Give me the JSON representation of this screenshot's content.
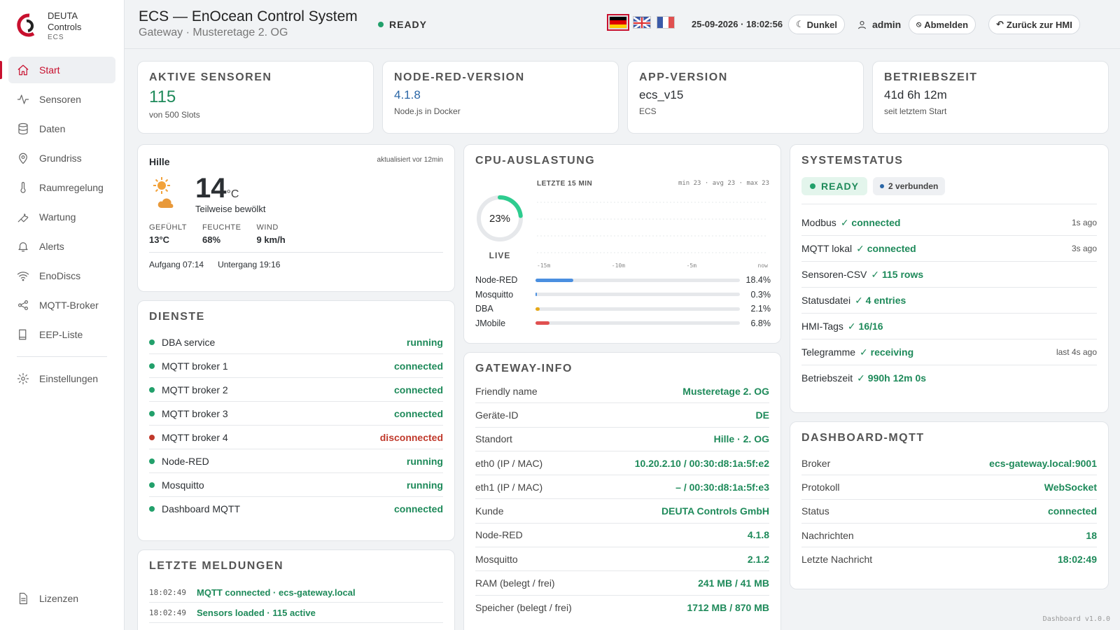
{
  "brand": {
    "line1": "DEUTA",
    "line2": "Controls",
    "line3": "ECS"
  },
  "nav": [
    {
      "label": "Start",
      "icon": "home-icon"
    },
    {
      "label": "Sensoren",
      "icon": "activity-icon"
    },
    {
      "label": "Daten",
      "icon": "database-icon"
    },
    {
      "label": "Grundriss",
      "icon": "map-pin-icon"
    },
    {
      "label": "Raumregelung",
      "icon": "thermometer-icon"
    },
    {
      "label": "Wartung",
      "icon": "wrench-icon"
    },
    {
      "label": "Alerts",
      "icon": "bell-icon"
    },
    {
      "label": "EnoDiscs",
      "icon": "wifi-icon"
    },
    {
      "label": "MQTT-Broker",
      "icon": "share-icon"
    },
    {
      "label": "EEP-Liste",
      "icon": "book-icon"
    }
  ],
  "nav_settings": "Einstellungen",
  "nav_licenses": "Lizenzen",
  "header": {
    "title": "ECS — EnOcean Control System",
    "subtitle": "Gateway · Musteretage 2. OG",
    "status": "READY",
    "datetime": "25-09-2026 · 18:02:56",
    "dark_label": "Dunkel",
    "user": "admin",
    "logout": "Abmelden",
    "back": "Zurück zur HMI"
  },
  "kpis": {
    "sensors": {
      "title": "AKTIVE SENSOREN",
      "value": "115",
      "sub": "von 500 Slots"
    },
    "nodered": {
      "title": "NODE-RED-VERSION",
      "value": "4.1.8",
      "sub": "Node.js in Docker"
    },
    "app": {
      "title": "APP-VERSION",
      "value": "ecs_v15",
      "sub": "ECS"
    },
    "uptime": {
      "title": "BETRIEBSZEIT",
      "value": "41d 6h 12m",
      "sub": "seit letztem Start"
    }
  },
  "weather": {
    "city": "Hille",
    "updated": "aktualisiert vor 12min",
    "temp": "14",
    "unit": "°C",
    "desc": "Teilweise bewölkt",
    "felt_label": "GEFÜHLT",
    "felt": "13°C",
    "humidity_label": "FEUCHTE",
    "humidity": "68%",
    "wind_label": "WIND",
    "wind": "9 km/h",
    "sunrise": "Aufgang 07:14",
    "sunset": "Untergang 19:16"
  },
  "services": {
    "title": "DIENSTE",
    "items": [
      {
        "name": "DBA service",
        "state": "running",
        "ok": true
      },
      {
        "name": "MQTT broker 1",
        "state": "connected",
        "ok": true
      },
      {
        "name": "MQTT broker 2",
        "state": "connected",
        "ok": true
      },
      {
        "name": "MQTT broker 3",
        "state": "connected",
        "ok": true
      },
      {
        "name": "MQTT broker 4",
        "state": "disconnected",
        "ok": false
      },
      {
        "name": "Node-RED",
        "state": "running",
        "ok": true
      },
      {
        "name": "Mosquitto",
        "state": "running",
        "ok": true
      },
      {
        "name": "Dashboard MQTT",
        "state": "connected",
        "ok": true
      }
    ]
  },
  "messages": {
    "title": "LETZTE MELDUNGEN",
    "items": [
      {
        "time": "18:02:49",
        "text": "MQTT connected · ecs-gateway.local"
      },
      {
        "time": "18:02:49",
        "text": "Sensors loaded · 115 active"
      }
    ]
  },
  "cpu": {
    "title": "CPU-AUSLASTUNG",
    "percent_label": "23%",
    "percent": 23,
    "live": "LIVE",
    "range_label": "LETZTE 15 MIN",
    "stats": "min 23 · avg 23 · max 23",
    "ticks": [
      "-15m",
      "-10m",
      "-5m",
      "now"
    ],
    "procs": [
      {
        "name": "Node-RED",
        "pct": 18.4,
        "label": "18.4%",
        "color": "#4a8fe0"
      },
      {
        "name": "Mosquitto",
        "pct": 0.3,
        "label": "0.3%",
        "color": "#4a8fe0"
      },
      {
        "name": "DBA",
        "pct": 2.1,
        "label": "2.1%",
        "color": "#e6a817"
      },
      {
        "name": "JMobile",
        "pct": 6.8,
        "label": "6.8%",
        "color": "#e05050"
      }
    ]
  },
  "gateway": {
    "title": "GATEWAY-INFO",
    "rows": [
      {
        "k": "Friendly name",
        "v": "Musteretage 2. OG"
      },
      {
        "k": "Geräte-ID",
        "v": "DE"
      },
      {
        "k": "Standort",
        "v": "Hille · 2. OG"
      },
      {
        "k": "eth0 (IP / MAC)",
        "v": "10.20.2.10 / 00:30:d8:1a:5f:e2"
      },
      {
        "k": "eth1 (IP / MAC)",
        "v": "– / 00:30:d8:1a:5f:e3"
      },
      {
        "k": "Kunde",
        "v": "DEUTA Controls GmbH"
      },
      {
        "k": "Node-RED",
        "v": "4.1.8"
      },
      {
        "k": "Mosquitto",
        "v": "2.1.2"
      },
      {
        "k": "RAM (belegt / frei)",
        "v": "241 MB / 41 MB"
      },
      {
        "k": "Speicher (belegt / frei)",
        "v": "1712 MB / 870 MB"
      }
    ]
  },
  "system": {
    "title": "SYSTEMSTATUS",
    "ready": "READY",
    "connected": "2 verbunden",
    "rows": [
      {
        "k": "Modbus",
        "v": "✓ connected",
        "ago": "1s ago"
      },
      {
        "k": "MQTT lokal",
        "v": "✓ connected",
        "ago": "3s ago"
      },
      {
        "k": "Sensoren-CSV",
        "v": "✓ 115 rows",
        "ago": ""
      },
      {
        "k": "Statusdatei",
        "v": "✓ 4 entries",
        "ago": ""
      },
      {
        "k": "HMI-Tags",
        "v": "✓ 16/16",
        "ago": ""
      },
      {
        "k": "Telegramme",
        "v": "✓ receiving",
        "ago": "last 4s ago"
      },
      {
        "k": "Betriebszeit",
        "v": "✓ 990h 12m 0s",
        "ago": ""
      }
    ]
  },
  "dmqtt": {
    "title": "DASHBOARD-MQTT",
    "rows": [
      {
        "k": "Broker",
        "v": "ecs-gateway.local:9001"
      },
      {
        "k": "Protokoll",
        "v": "WebSocket"
      },
      {
        "k": "Status",
        "v": "connected"
      },
      {
        "k": "Nachrichten",
        "v": "18"
      },
      {
        "k": "Letzte Nachricht",
        "v": "18:02:49"
      }
    ]
  },
  "footer": "Dashboard v1.0.0"
}
